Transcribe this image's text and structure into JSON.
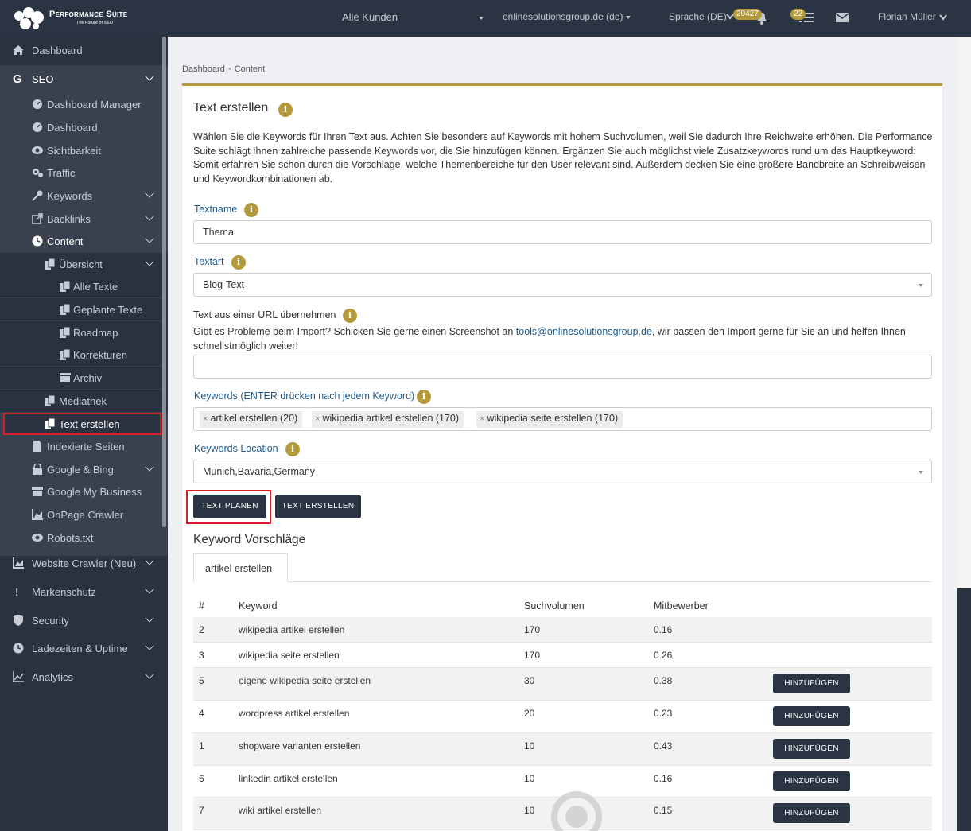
{
  "app": {
    "logo_title": "Performance Suite",
    "logo_subtitle": "The Future of SEO"
  },
  "topbar": {
    "customer_select": "Alle Kunden",
    "domain_select": "onlinesolutionsgroup.de (de)",
    "language": "Sprache (DE)",
    "notifications_badge": "20427",
    "tasks_badge": "22",
    "user": "Florian Müller"
  },
  "sidebar": {
    "dashboard": "Dashboard",
    "seo": "SEO",
    "seo_items": {
      "dashboard_manager": "Dashboard Manager",
      "dashboard": "Dashboard",
      "sichtbarkeit": "Sichtbarkeit",
      "traffic": "Traffic",
      "keywords": "Keywords",
      "backlinks": "Backlinks",
      "content": "Content",
      "uebersicht": "Übersicht",
      "alle_texte": "Alle Texte",
      "geplante_texte": "Geplante Texte",
      "roadmap": "Roadmap",
      "korrekturen": "Korrekturen",
      "archiv": "Archiv",
      "mediathek": "Mediathek",
      "text_erstellen": "Text erstellen",
      "indexierte_seiten": "Indexierte Seiten",
      "google_bing": "Google & Bing",
      "google_my_business": "Google My Business",
      "onpage_crawler": "OnPage Crawler",
      "robots": "Robots.txt"
    },
    "website_crawler": "Website Crawler (Neu)",
    "markenschutz": "Markenschutz",
    "security": "Security",
    "ladezeiten": "Ladezeiten & Uptime",
    "analytics": "Analytics"
  },
  "breadcrumb": {
    "root": "Dashboard",
    "current": "Content"
  },
  "form": {
    "title": "Text erstellen",
    "intro": "Wählen Sie die Keywords für Ihren Text aus. Achten Sie besonders auf Keywords mit hohem Suchvolumen, weil Sie dadurch Ihre Reichweite erhöhen. Die Performance Suite schlägt Ihnen zahlreiche passende Keywords vor, die Sie hinzufügen können. Ergänzen Sie auch möglichst viele Zusatzkeywords rund um das Hauptkeyword: Somit erfahren Sie schon durch die Vorschläge, welche Themenbereiche für den User relevant sind. Außerdem decken Sie eine größere Bandbreite an Schreibweisen und Keywordkombinationen ab.",
    "textname_label": "Textname",
    "textname_value": "Thema",
    "textart_label": "Textart",
    "textart_value": "Blog-Text",
    "url_label": "Text aus einer URL übernehmen",
    "url_help_1": "Gibt es Probleme beim Import? Schicken Sie gerne einen Screenshot an ",
    "url_help_email": "tools@onlinesolutionsgroup.de",
    "url_help_2": ", wir passen den Import gerne für Sie an und helfen Ihnen schnellstmöglich weiter!",
    "url_value": "",
    "keywords_label": "Keywords (ENTER drücken nach jedem Keyword)",
    "keyword_tags": [
      "artikel erstellen (20)",
      "wikipedia artikel erstellen (170)",
      "wikipedia seite erstellen (170)"
    ],
    "tag_remove": "×",
    "location_label": "Keywords Location",
    "location_value": "Munich,Bavaria,Germany",
    "btn_plan": "TEXT PLANEN",
    "btn_create": "TEXT ERSTELLEN"
  },
  "suggestions": {
    "title": "Keyword Vorschläge",
    "tab": "artikel erstellen",
    "columns": [
      "#",
      "Keyword",
      "Suchvolumen",
      "Mitbewerber"
    ],
    "add_label": "HINZUFÜGEN",
    "rows": [
      {
        "n": "2",
        "keyword": "wikipedia artikel erstellen",
        "volume": "170",
        "competition": "0.16",
        "add": false
      },
      {
        "n": "3",
        "keyword": "wikipedia seite erstellen",
        "volume": "170",
        "competition": "0.26",
        "add": false
      },
      {
        "n": "5",
        "keyword": "eigene wikipedia seite erstellen",
        "volume": "30",
        "competition": "0.38",
        "add": true
      },
      {
        "n": "4",
        "keyword": "wordpress artikel erstellen",
        "volume": "20",
        "competition": "0.23",
        "add": true
      },
      {
        "n": "1",
        "keyword": "shopware varianten erstellen",
        "volume": "10",
        "competition": "0.43",
        "add": true
      },
      {
        "n": "6",
        "keyword": "linkedin artikel erstellen",
        "volume": "10",
        "competition": "0.16",
        "add": true
      },
      {
        "n": "7",
        "keyword": "wiki artikel erstellen",
        "volume": "10",
        "competition": "0.15",
        "add": true
      }
    ]
  },
  "colors": {
    "accent": "#b59a3c",
    "dark": "#2b3442",
    "highlight": "#d0202a"
  }
}
